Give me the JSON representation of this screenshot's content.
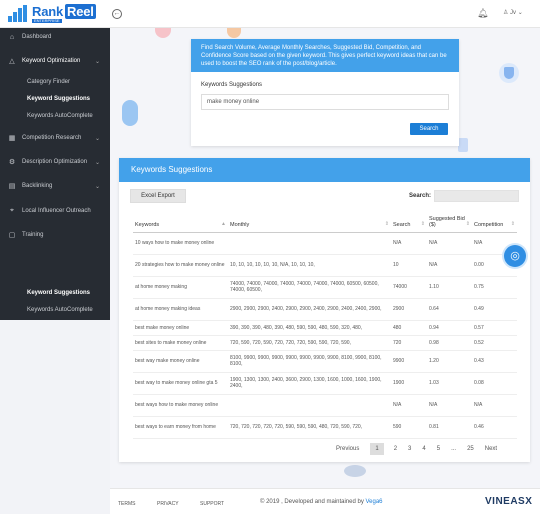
{
  "header": {
    "logo_name": "Rank",
    "logo_name2": "Reel",
    "logo_tag": "ENTERPRISE",
    "back_icon": "back-arrow-icon",
    "bell_icon": "bell-icon",
    "user_label": "Jv"
  },
  "sidebar": {
    "items": [
      {
        "label": "Dashboard",
        "icon": "home-icon",
        "glyph": "⌂"
      },
      {
        "label": "Keyword Optimization",
        "icon": "warning-icon",
        "glyph": "△"
      },
      {
        "label": "Competition Research",
        "icon": "chart-icon",
        "glyph": "▦"
      },
      {
        "label": "Description Optimization",
        "icon": "settings-icon",
        "glyph": "⚙"
      },
      {
        "label": "Backlinking",
        "icon": "link-icon",
        "glyph": "▤"
      },
      {
        "label": "Local Influencer Outreach",
        "icon": "tag-icon",
        "glyph": "⌖"
      },
      {
        "label": "Training",
        "icon": "book-icon",
        "glyph": "▢"
      }
    ],
    "sub": [
      "Category Finder",
      "Keyword Suggestions",
      "Keywords AutoComplete"
    ],
    "lower_sub": [
      "Keyword Suggestions",
      "Keywords AutoComplete"
    ]
  },
  "search_card": {
    "description": "Find Search Volume, Average Monthly Searches, Suggested Bid, Competition, and Confidence Score based on the given keyword. This gives perfect keyword ideas that can be used to boost the SEO rank of the post/blog/article.",
    "label": "Keywords Suggestions",
    "input_value": "make money online",
    "button": "Search"
  },
  "results": {
    "title": "Keywords Suggestions",
    "excel_button": "Excel Export",
    "search_label": "Search:",
    "columns": [
      "Keywords",
      "Monthly",
      "Search",
      "Suggested Bid ($)",
      "Competition"
    ],
    "rows": [
      {
        "k": "10 ways how to make money online",
        "m": "",
        "s": "N/A",
        "b": "N/A",
        "c": "N/A"
      },
      {
        "k": "20 strategies how to make money online",
        "m": "10, 10, 10, 10, 10, 10, N/A, 10, 10, 10,",
        "s": "10",
        "b": "N/A",
        "c": "0.00"
      },
      {
        "k": "at home money making",
        "m": "74000, 74000, 74000, 74000, 74000, 74000, 74000, 60500, 60500, 74000, 60500,",
        "s": "74000",
        "b": "1.10",
        "c": "0.75"
      },
      {
        "k": "at home money making ideas",
        "m": "2900, 2900, 2900, 2400, 2900, 2900, 2400, 2900, 2400, 2400, 2900,",
        "s": "2900",
        "b": "0.64",
        "c": "0.49"
      },
      {
        "k": "best make money online",
        "m": "390, 390, 390, 480, 390, 480, 590, 590, 480, 590, 320, 480,",
        "s": "480",
        "b": "0.94",
        "c": "0.57"
      },
      {
        "k": "best sites to make money online",
        "m": "720, 590, 720, 590, 720, 720, 720, 590, 590, 720, 590,",
        "s": "720",
        "b": "0.98",
        "c": "0.52"
      },
      {
        "k": "best way make money online",
        "m": "8100, 9900, 9900, 9900, 9900, 9900, 9900, 9900, 8100, 9900, 8100, 8100,",
        "s": "9900",
        "b": "1.20",
        "c": "0.43"
      },
      {
        "k": "best way to make money online gta 5",
        "m": "1900, 1300, 1300, 2400, 3600, 2900, 1300, 1600, 1000, 1600, 1900, 2400,",
        "s": "1900",
        "b": "1.03",
        "c": "0.08"
      },
      {
        "k": "best ways how to make money online",
        "m": "",
        "s": "N/A",
        "b": "N/A",
        "c": "N/A"
      },
      {
        "k": "best ways to earn money from home",
        "m": "720, 720, 720, 720, 720, 590, 590, 590, 480, 720, 590, 720,",
        "s": "590",
        "b": "0.81",
        "c": "0.46"
      }
    ],
    "pager": {
      "prev": "Previous",
      "pages": [
        "1",
        "2",
        "3",
        "4",
        "5",
        "...",
        "25"
      ],
      "next": "Next"
    },
    "float_icon": "lifebuoy-icon"
  },
  "footer": {
    "links": [
      "TERMS",
      "PRIVACY",
      "SUPPORT"
    ],
    "copy": "© 2019 , Developed and maintained by ",
    "copy_link": "Vega6",
    "brand": "VINEASX"
  }
}
